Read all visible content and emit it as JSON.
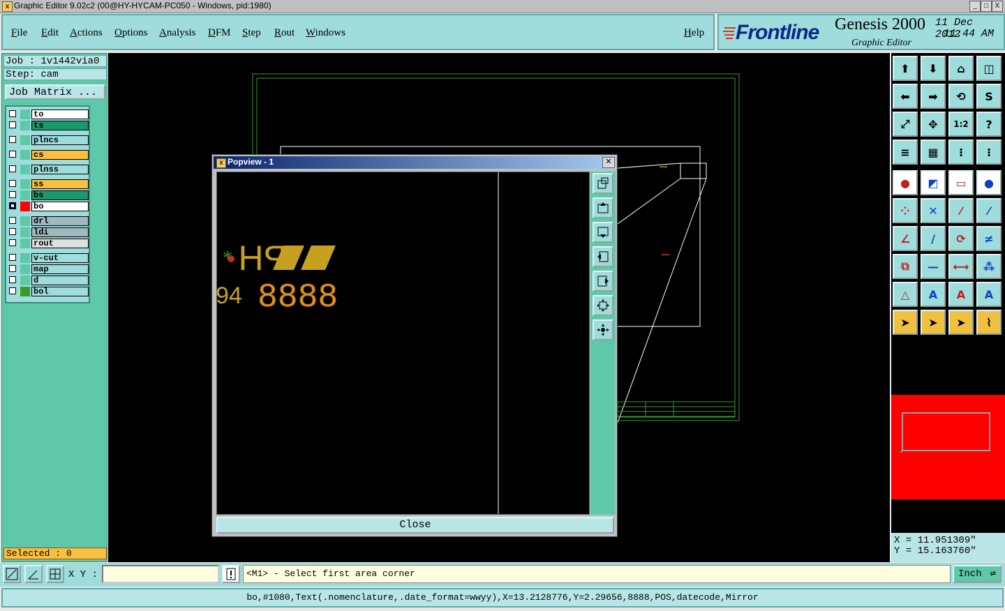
{
  "window": {
    "title": "Graphic Editor 9.02c2 (00@HY-HYCAM-PC050 - Windows, pid:1980)",
    "app_icon": "x-icon",
    "buttons": [
      "_",
      "□",
      "X"
    ]
  },
  "menubar": {
    "items": [
      "File",
      "Edit",
      "Actions",
      "Options",
      "Analysis",
      "DFM",
      "Step",
      "Rout",
      "Windows"
    ],
    "help": "Help"
  },
  "brand": {
    "logo": "Frontline",
    "product": "Genesis 2000",
    "subtitle": "Graphic Editor",
    "date": "11 Dec 2012",
    "time": "11:44 AM"
  },
  "left": {
    "job": "Job : 1v1442via0",
    "step": "Step: cam",
    "job_matrix": "Job Matrix ...",
    "layers": [
      {
        "name": "to",
        "bg": "#ffffff",
        "color": "#5fc8a8",
        "checked": false
      },
      {
        "name": "ts",
        "bg": "#1a9a6a",
        "color": "#5fc8a8",
        "checked": false
      },
      {
        "name": "plncs",
        "bg": "#9fdcdc",
        "color": "#5fc8a8",
        "checked": false
      },
      {
        "name": "cs",
        "bg": "#f8c040",
        "color": "#5fc8a8",
        "checked": false
      },
      {
        "name": "plnss",
        "bg": "#9fdcdc",
        "color": "#5fc8a8",
        "checked": false
      },
      {
        "name": "ss",
        "bg": "#f8c040",
        "color": "#5fc8a8",
        "checked": false
      },
      {
        "name": "bs",
        "bg": "#1a9a6a",
        "color": "#5fc8a8",
        "checked": false
      },
      {
        "name": "bo",
        "bg": "#ffffff",
        "color": "#ff0000",
        "checked": true
      },
      {
        "name": "drl",
        "bg": "#a0b8c0",
        "color": "#5fc8a8",
        "checked": false
      },
      {
        "name": "ldi",
        "bg": "#a0b8c0",
        "color": "#5fc8a8",
        "checked": false
      },
      {
        "name": "rout",
        "bg": "#e0e0e0",
        "color": "#5fc8a8",
        "checked": false
      },
      {
        "name": "v-cut",
        "bg": "#9fdcdc",
        "color": "#5fc8a8",
        "checked": false
      },
      {
        "name": "map",
        "bg": "#9fdcdc",
        "color": "#5fc8a8",
        "checked": false
      },
      {
        "name": "d",
        "bg": "#9fdcdc",
        "color": "#5fc8a8",
        "checked": false
      },
      {
        "name": "bol",
        "bg": "#9fdcdc",
        "color": "#3a9a2a",
        "checked": false
      }
    ],
    "selected": "Selected : 0"
  },
  "popview": {
    "title": "Popview - 1",
    "close_label": "Close",
    "preview_text_top": "PH",
    "preview_text_bottom": "8888",
    "preview_text_left": "94"
  },
  "right": {
    "x": "X = 11.951309\"",
    "y": "Y = 15.163760\"",
    "zoom_label": "1:2"
  },
  "bottom": {
    "xy_label": "X Y :",
    "xy_value": "",
    "prompt": "<M1> - Select first area corner",
    "unit": "Inch",
    "status": "bo,#1080,Text(.nomenclature,.date_format=wwyy),X=13.2128776,Y=2.29656,8888,POS,datecode,Mirror"
  },
  "colors": {
    "accent": "#9fdcdc",
    "panel": "#5fc8a8",
    "minimap": "#ff0000",
    "highlight": "#f0c040"
  }
}
